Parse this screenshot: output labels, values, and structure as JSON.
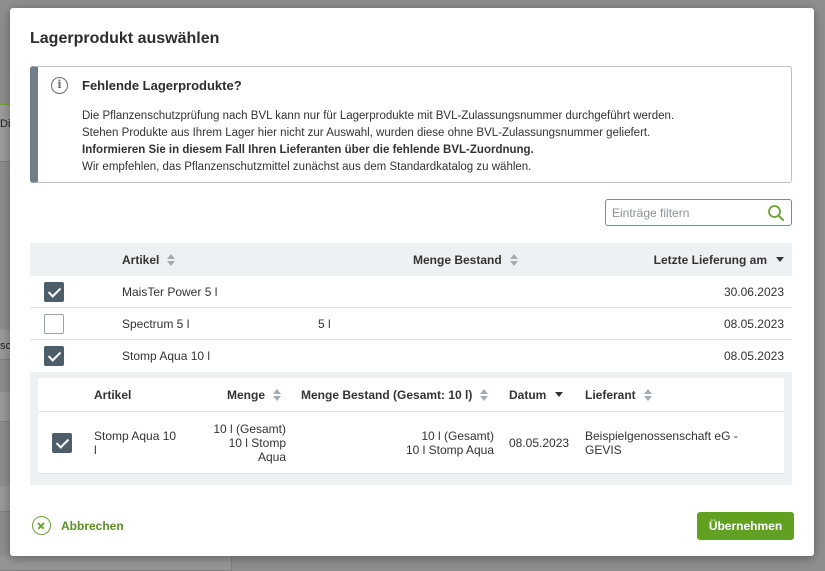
{
  "background": {
    "fragment_1": "Die",
    "fragment_2": "sc"
  },
  "dialog": {
    "title": "Lagerprodukt auswählen",
    "info": {
      "icon": "info-icon",
      "heading": "Fehlende Lagerprodukte?",
      "line1": "Die Pflanzenschutzprüfung nach BVL kann nur für Lagerprodukte mit BVL-Zulassungsnummer durchgeführt werden.",
      "line2": "Stehen Produkte aus Ihrem Lager hier nicht zur Auswahl, wurden diese ohne BVL-Zulassungsnummer geliefert.",
      "line3": "Informieren Sie in diesem Fall Ihren Lieferanten über die fehlende BVL-Zuordnung.",
      "line4": "Wir empfehlen, das Pflanzenschutzmittel zunächst aus dem Standardkatalog zu wählen."
    },
    "filter": {
      "placeholder": "Einträge filtern",
      "value": ""
    },
    "table": {
      "columns": {
        "artikel": "Artikel",
        "menge_bestand": "Menge Bestand",
        "letzte_lieferung": "Letzte Lieferung am"
      },
      "rows": [
        {
          "checked": true,
          "artikel": "MaisTer Power 5 l",
          "menge_bestand": "",
          "letzte_lieferung": "30.06.2023"
        },
        {
          "checked": false,
          "artikel": "Spectrum 5 l",
          "menge_bestand": "5 l",
          "letzte_lieferung": "08.05.2023"
        },
        {
          "checked": true,
          "artikel": "Stomp Aqua 10 l",
          "menge_bestand": "",
          "letzte_lieferung": "08.05.2023"
        }
      ]
    },
    "subtable": {
      "columns": {
        "artikel": "Artikel",
        "menge": "Menge",
        "menge_bestand": "Menge Bestand (Gesamt: 10 l)",
        "datum": "Datum",
        "lieferant": "Lieferant"
      },
      "row": {
        "checked": true,
        "artikel_line1": "Stomp Aqua 10",
        "artikel_line2": "l",
        "menge_line1": "10 l (Gesamt)",
        "menge_line2": "10 l Stomp",
        "menge_line3": "Aqua",
        "bestand_line1": "10 l (Gesamt)",
        "bestand_line2": "10 l Stomp Aqua",
        "datum": "08.05.2023",
        "lieferant_line1": "Beispielgenossenschaft eG -",
        "lieferant_line2": "GEVIS"
      }
    },
    "footer": {
      "cancel_label": "Abbrechen",
      "confirm_label": "Übernehmen"
    }
  },
  "colors": {
    "accent_green": "#62a020",
    "checkbox_dark": "#4e5d6a",
    "info_border": "#6f7f8a"
  }
}
